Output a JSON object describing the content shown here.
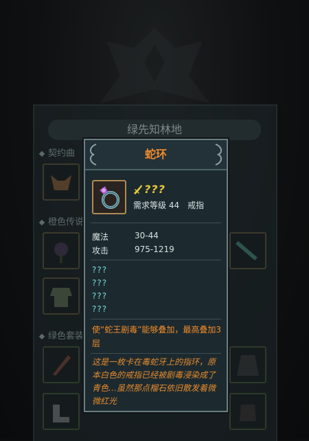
{
  "background": {
    "title": "绿先知林地",
    "sections": [
      "契约曲",
      "橙色传说",
      "绿色套装"
    ]
  },
  "tooltip": {
    "title": "蛇环",
    "item_icon": "ring-icon",
    "name_unknown": "???",
    "required_level": "需求等级 44",
    "item_type": "戒指",
    "stats": [
      {
        "label": "魔法",
        "value": "30-44"
      },
      {
        "label": "攻击",
        "value": "975-1219"
      }
    ],
    "unknown_affixes": [
      "???",
      "???",
      "???",
      "???"
    ],
    "effect": "使“蛇王剧毒”能够叠加，最高叠加3层",
    "lore": "这是一枚卡在毒蛇牙上的指环，原本白色的戒指已经被剧毒浸染成了青色…虽然那点榴石依旧散发着微微红光",
    "colors": {
      "title": "#f08a2c",
      "unknown_name": "#e8c83a",
      "unknown_affix": "#7ad9d9",
      "effect": "#f08a2c"
    }
  }
}
